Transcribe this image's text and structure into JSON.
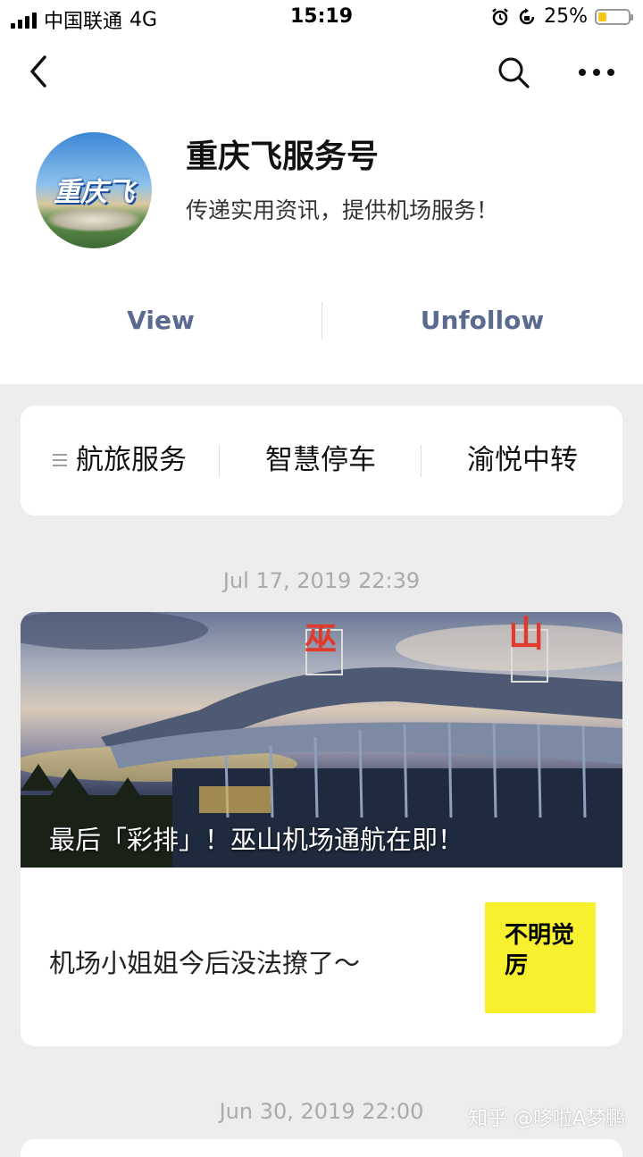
{
  "status_bar": {
    "carrier": "中国联通",
    "network": "4G",
    "time": "15:19",
    "battery": "25%"
  },
  "nav": {
    "back_icon": "chevron-left-icon",
    "search_icon": "search-icon",
    "more_icon": "more-icon"
  },
  "profile": {
    "name": "重庆飞服务号",
    "description": "传递实用资讯，提供机场服务！",
    "avatar_text": "重庆飞",
    "view_label": "View",
    "unfollow_label": "Unfollow"
  },
  "menu": {
    "items": [
      "航旅服务",
      "智慧停车",
      "渝悦中转"
    ]
  },
  "feed": [
    {
      "timestamp": "Jul 17, 2019 22:39",
      "cover_title": "最后「彩排」！巫山机场通航在即！",
      "sub_title": "机场小姐姐今后没法撩了～",
      "thumb_text": "不明觉厉"
    },
    {
      "timestamp": "Jun 30, 2019 22:00"
    }
  ],
  "watermark": "知乎 @哆啦A梦鹏",
  "colors": {
    "accent": "#5b6a91",
    "background": "#ededed",
    "thumb_yellow": "#f7f02f"
  }
}
